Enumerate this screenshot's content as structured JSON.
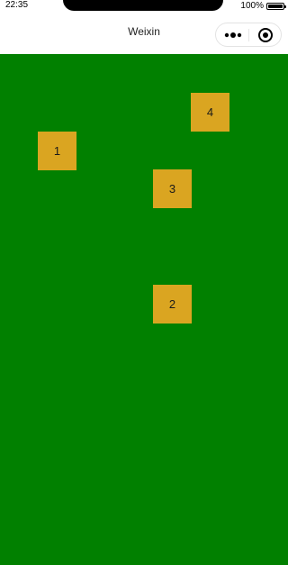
{
  "status_bar": {
    "time": "22:35",
    "battery_percent": "100%"
  },
  "nav_bar": {
    "title": "Weixin",
    "more_icon": "more-dots-icon",
    "close_icon": "target-circle-icon"
  },
  "canvas": {
    "background": "#018000",
    "box_color": "#daa521",
    "boxes": [
      {
        "label": "4"
      },
      {
        "label": "1"
      },
      {
        "label": "3"
      },
      {
        "label": "2"
      }
    ]
  }
}
